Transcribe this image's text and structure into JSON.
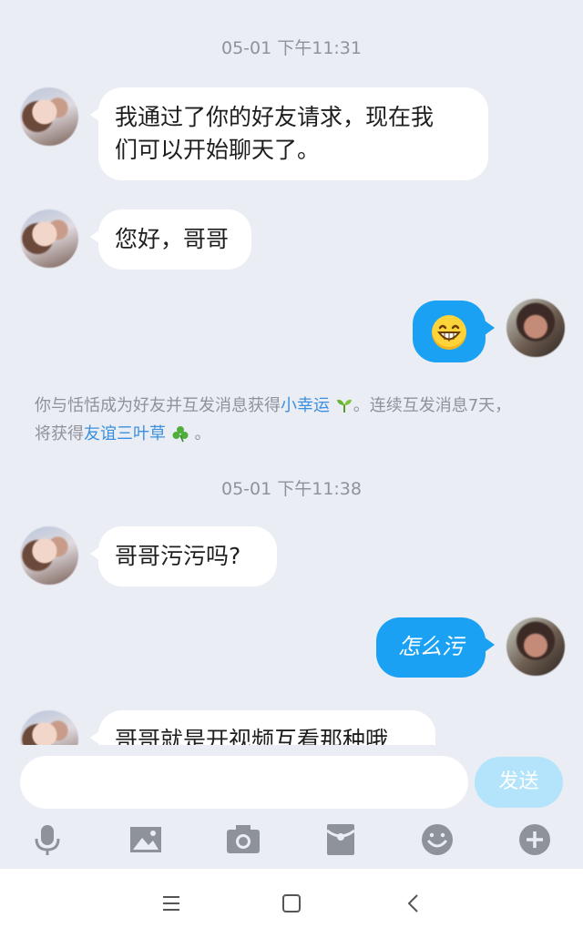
{
  "chat": {
    "timestamps": [
      "05-01 下午11:31",
      "05-01 下午11:38"
    ],
    "messages": [
      {
        "side": "left",
        "lines": [
          "我通过了你的好友请求，现在我",
          "们可以开始聊天了。"
        ]
      },
      {
        "side": "left",
        "text": "您好，哥哥"
      },
      {
        "side": "right",
        "type": "emoji",
        "emoji": "grinning-face-emoji"
      },
      {
        "side": "left",
        "text": "哥哥污污吗?"
      },
      {
        "side": "right",
        "text": "怎么污"
      },
      {
        "side": "left",
        "text": "哥哥就是开视频互看那种哦"
      }
    ],
    "system_message": {
      "part1": "你与恬恬成为好友并互发消息获得",
      "link1": "小幸运",
      "part2": "。连续互发消息7天，",
      "part3": "将获得",
      "link2": "友谊三叶草",
      "part4": "。"
    }
  },
  "input": {
    "value": "",
    "send_label": "发送"
  },
  "toolbar": {
    "items": [
      "microphone-icon",
      "image-icon",
      "camera-icon",
      "red-packet-icon",
      "emoji-icon",
      "plus-icon"
    ]
  },
  "navbar": {
    "items": [
      "menu-icon",
      "home-square-icon",
      "back-chevron-icon"
    ]
  },
  "colors": {
    "background": "#ebedf5",
    "bubble_self": "#1aa1f3",
    "bubble_other": "#ffffff",
    "link": "#3a8fe0",
    "send_disabled": "#b3e4fb",
    "icon_gray": "#8e939b"
  }
}
